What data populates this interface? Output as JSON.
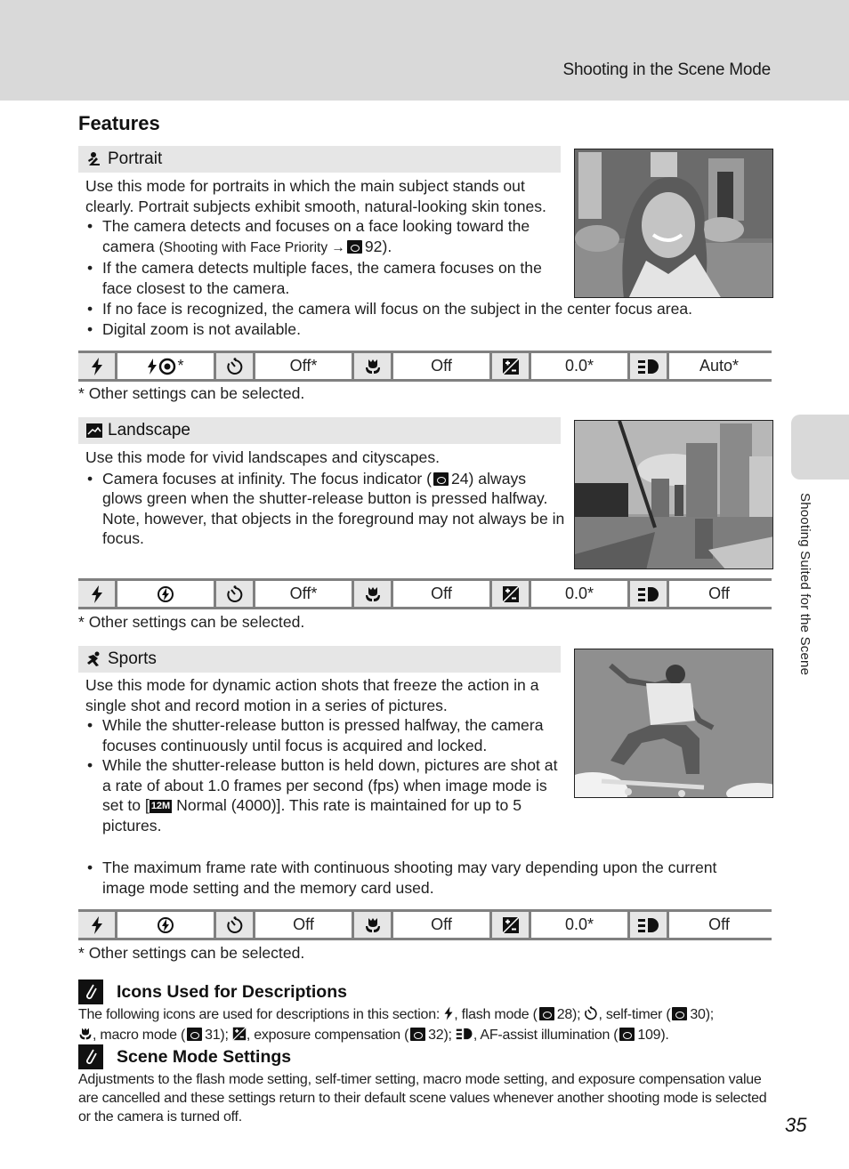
{
  "header": {
    "title": "Shooting in the Scene Mode"
  },
  "page_heading": "Features",
  "side_tab": {
    "label": "Shooting Suited for the Scene"
  },
  "sections": [
    {
      "mode_icon": "portrait-icon",
      "mode_label": "Portrait",
      "intro": "Use this mode for portraits in which the main subject stands out clearly. Portrait subjects exhibit smooth, natural-looking skin tones.",
      "bullets": [
        {
          "text_a": "The camera detects and focuses on a face looking toward the camera ",
          "text_small": "(Shooting with Face Priority →",
          "ref_page": "92",
          "text_b": ")."
        },
        {
          "text": "If the camera detects multiple faces, the camera focuses on the face closest to the camera."
        },
        {
          "text": "If no face is recognized, the camera will focus on the subject in the center focus area."
        },
        {
          "text": "Digital zoom is not available."
        }
      ],
      "photo_alt": "Portrait photo of smiling woman in front of brick house",
      "settings": {
        "flash": "*",
        "self_timer": "Off*",
        "macro": "Off",
        "exposure": "0.0*",
        "af_assist": "Auto*"
      },
      "flash_icon": "red-eye-reduction-icon",
      "footnote": "*  Other settings can be selected."
    },
    {
      "mode_icon": "landscape-icon",
      "mode_label": "Landscape",
      "intro": "Use this mode for vivid landscapes and cityscapes.",
      "bullets": [
        {
          "text_a": "Camera focuses at infinity. The focus indicator (",
          "ref_page": "24",
          "text_b": ") always glows green when the shutter-release button is pressed halfway. Note, however, that objects in the foreground may not always be in focus."
        }
      ],
      "photo_alt": "Harbor with sailboat mast and high-rise buildings",
      "settings": {
        "flash": "",
        "self_timer": "Off*",
        "macro": "Off",
        "exposure": "0.0*",
        "af_assist": "Off"
      },
      "flash_icon": "flash-off-icon",
      "footnote": "*  Other settings can be selected."
    },
    {
      "mode_icon": "sports-icon",
      "mode_label": "Sports",
      "intro": "Use this mode for dynamic action shots that freeze the action in a single shot and record motion in a series of pictures.",
      "bullets": [
        {
          "text": "While the shutter-release button is pressed halfway, the camera focuses continuously until focus is acquired and locked."
        },
        {
          "text_a": "While the shutter-release button is held down, pictures are shot at a rate of about 1.0 frames per second (fps) when image mode is set to [",
          "image_mode_badge": "12M",
          "text_b": " Normal (4000)]. This rate is maintained for up to 5 pictures."
        },
        {
          "text": "The maximum frame rate with continuous shooting may vary depending upon the current image mode setting and the memory card used."
        }
      ],
      "photo_alt": "Skateboarder jumping in the air against the sky",
      "settings": {
        "flash": "",
        "self_timer": "Off",
        "macro": "Off",
        "exposure": "0.0*",
        "af_assist": "Off"
      },
      "flash_icon": "flash-off-icon",
      "footnote": "*  Other settings can be selected."
    }
  ],
  "notes": [
    {
      "title": "Icons Used for Descriptions",
      "parts": {
        "p1": "The following icons are used for descriptions in this section: ",
        "p2": ", flash mode (",
        "r1": "28",
        "p3": "); ",
        "p4": ", self-timer (",
        "r2": "30",
        "p5": ");",
        "p6": ", macro mode (",
        "r3": "31",
        "p7": "); ",
        "p8": ", exposure compensation (",
        "r4": "32",
        "p9": "); ",
        "p10": ", AF-assist illumination (",
        "r5": "109",
        "p11": ")."
      }
    },
    {
      "title": "Scene Mode Settings",
      "text": "Adjustments to the flash mode setting, self-timer setting, macro mode setting, and exposure compensation value are cancelled and these settings return to their default scene values whenever another shooting mode is selected or the camera is turned off."
    }
  ],
  "page_number": "35"
}
